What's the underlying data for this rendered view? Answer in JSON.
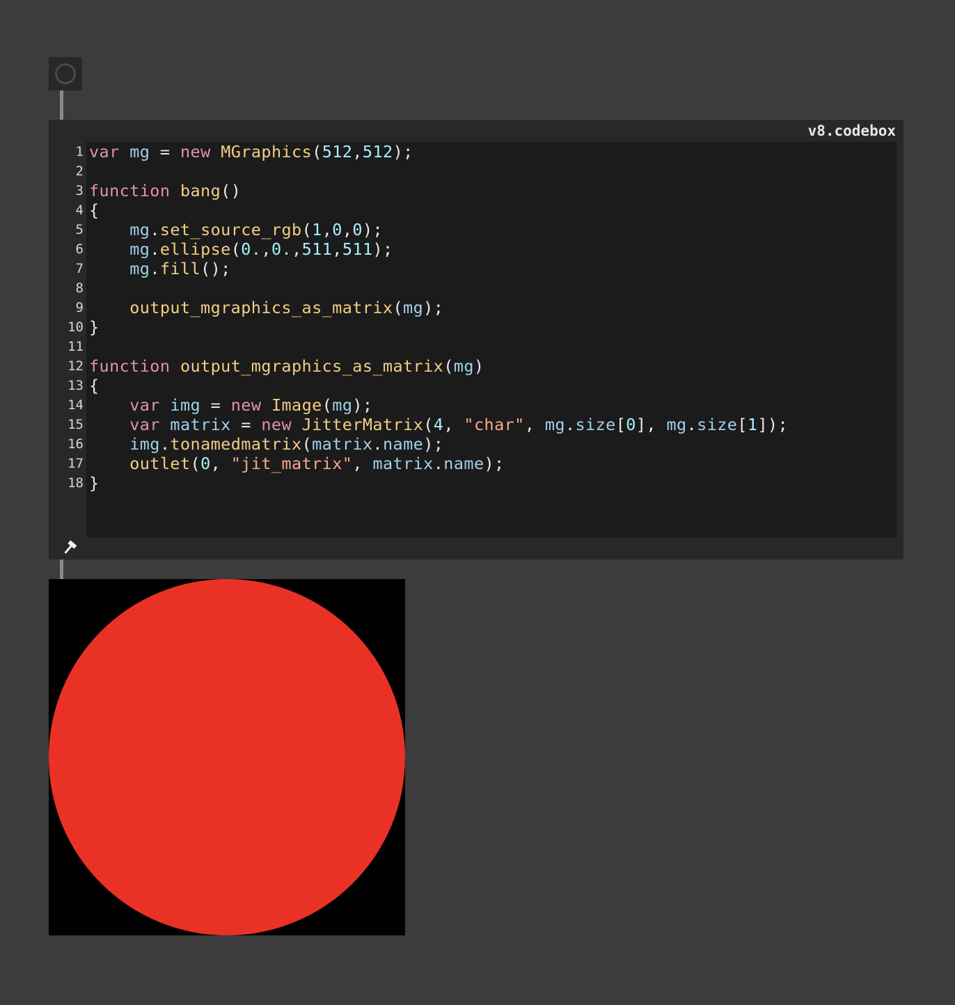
{
  "codebox": {
    "title": "v8.codebox",
    "line_numbers": [
      "1",
      "2",
      "3",
      "4",
      "5",
      "6",
      "7",
      "8",
      "9",
      "10",
      "11",
      "12",
      "13",
      "14",
      "15",
      "16",
      "17",
      "18"
    ],
    "lines": [
      [
        [
          "kw",
          "var"
        ],
        [
          "pn",
          " "
        ],
        [
          "vr",
          "mg"
        ],
        [
          "pn",
          " = "
        ],
        [
          "kw",
          "new"
        ],
        [
          "pn",
          " "
        ],
        [
          "fn",
          "MGraphics"
        ],
        [
          "pn",
          "("
        ],
        [
          "nm",
          "512"
        ],
        [
          "pn",
          ","
        ],
        [
          "nm",
          "512"
        ],
        [
          "pn",
          ");"
        ]
      ],
      [],
      [
        [
          "kw",
          "function"
        ],
        [
          "pn",
          " "
        ],
        [
          "fn",
          "bang"
        ],
        [
          "pn",
          "()"
        ]
      ],
      [
        [
          "pn",
          "{"
        ]
      ],
      [
        [
          "pn",
          "    "
        ],
        [
          "vr",
          "mg"
        ],
        [
          "pn",
          "."
        ],
        [
          "fn",
          "set_source_rgb"
        ],
        [
          "pn",
          "("
        ],
        [
          "nm",
          "1"
        ],
        [
          "pn",
          ","
        ],
        [
          "nm",
          "0"
        ],
        [
          "pn",
          ","
        ],
        [
          "nm",
          "0"
        ],
        [
          "pn",
          ");"
        ]
      ],
      [
        [
          "pn",
          "    "
        ],
        [
          "vr",
          "mg"
        ],
        [
          "pn",
          "."
        ],
        [
          "fn",
          "ellipse"
        ],
        [
          "pn",
          "("
        ],
        [
          "nm",
          "0."
        ],
        [
          "pn",
          ","
        ],
        [
          "nm",
          "0."
        ],
        [
          "pn",
          ","
        ],
        [
          "nm",
          "511"
        ],
        [
          "pn",
          ","
        ],
        [
          "nm",
          "511"
        ],
        [
          "pn",
          ");"
        ]
      ],
      [
        [
          "pn",
          "    "
        ],
        [
          "vr",
          "mg"
        ],
        [
          "pn",
          "."
        ],
        [
          "fn",
          "fill"
        ],
        [
          "pn",
          "();"
        ]
      ],
      [],
      [
        [
          "pn",
          "    "
        ],
        [
          "fn",
          "output_mgraphics_as_matrix"
        ],
        [
          "pn",
          "("
        ],
        [
          "vr",
          "mg"
        ],
        [
          "pn",
          ");"
        ]
      ],
      [
        [
          "pn",
          "}"
        ]
      ],
      [],
      [
        [
          "kw",
          "function"
        ],
        [
          "pn",
          " "
        ],
        [
          "fn",
          "output_mgraphics_as_matrix"
        ],
        [
          "pn",
          "("
        ],
        [
          "vr",
          "mg"
        ],
        [
          "pn",
          ")"
        ]
      ],
      [
        [
          "pn",
          "{"
        ]
      ],
      [
        [
          "pn",
          "    "
        ],
        [
          "kw",
          "var"
        ],
        [
          "pn",
          " "
        ],
        [
          "vr",
          "img"
        ],
        [
          "pn",
          " = "
        ],
        [
          "kw",
          "new"
        ],
        [
          "pn",
          " "
        ],
        [
          "fn",
          "Image"
        ],
        [
          "pn",
          "("
        ],
        [
          "vr",
          "mg"
        ],
        [
          "pn",
          ");"
        ]
      ],
      [
        [
          "pn",
          "    "
        ],
        [
          "kw",
          "var"
        ],
        [
          "pn",
          " "
        ],
        [
          "vr",
          "matrix"
        ],
        [
          "pn",
          " = "
        ],
        [
          "kw",
          "new"
        ],
        [
          "pn",
          " "
        ],
        [
          "fn",
          "JitterMatrix"
        ],
        [
          "pn",
          "("
        ],
        [
          "nm",
          "4"
        ],
        [
          "pn",
          ", "
        ],
        [
          "st",
          "\"char\""
        ],
        [
          "pn",
          ", "
        ],
        [
          "vr",
          "mg"
        ],
        [
          "pn",
          "."
        ],
        [
          "vr",
          "size"
        ],
        [
          "pn",
          "["
        ],
        [
          "nm",
          "0"
        ],
        [
          "pn",
          "], "
        ],
        [
          "vr",
          "mg"
        ],
        [
          "pn",
          "."
        ],
        [
          "vr",
          "size"
        ],
        [
          "pn",
          "["
        ],
        [
          "nm",
          "1"
        ],
        [
          "pn",
          "]);"
        ]
      ],
      [
        [
          "pn",
          "    "
        ],
        [
          "vr",
          "img"
        ],
        [
          "pn",
          "."
        ],
        [
          "fn",
          "tonamedmatrix"
        ],
        [
          "pn",
          "("
        ],
        [
          "vr",
          "matrix"
        ],
        [
          "pn",
          "."
        ],
        [
          "vr",
          "name"
        ],
        [
          "pn",
          ");"
        ]
      ],
      [
        [
          "pn",
          "    "
        ],
        [
          "fn",
          "outlet"
        ],
        [
          "pn",
          "("
        ],
        [
          "nm",
          "0"
        ],
        [
          "pn",
          ", "
        ],
        [
          "st",
          "\"jit_matrix\""
        ],
        [
          "pn",
          ", "
        ],
        [
          "vr",
          "matrix"
        ],
        [
          "pn",
          "."
        ],
        [
          "vr",
          "name"
        ],
        [
          "pn",
          ");"
        ]
      ],
      [
        [
          "pn",
          "}"
        ]
      ]
    ]
  },
  "icons": {
    "bang": "bang-button-icon",
    "hammer": "hammer-icon"
  },
  "colors": {
    "patcher_bg": "#3c3c3c",
    "object_bg": "#282828",
    "editor_bg": "#1b1b1b",
    "disc": "#e93225",
    "matrix_bg": "#000000"
  }
}
